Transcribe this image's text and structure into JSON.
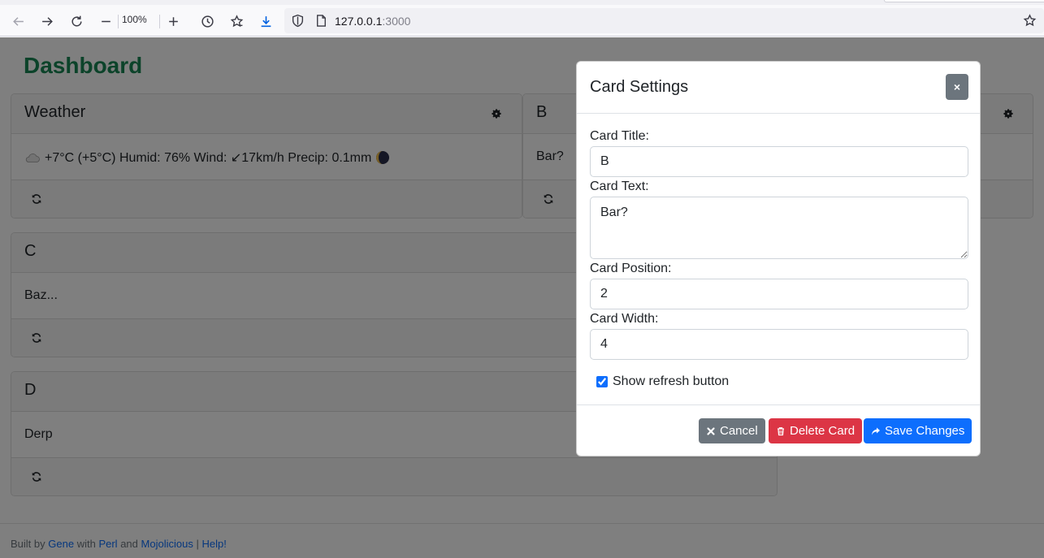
{
  "browser": {
    "zoom_level": "100%",
    "url_host": "127.0.0.1",
    "url_port": ":3000",
    "icons": [
      "back-icon",
      "forward-icon",
      "reload-icon",
      "zoom-out-icon",
      "zoom-in-icon",
      "history-icon",
      "bookmarks-icon",
      "download-icon",
      "shield-icon",
      "page-icon",
      "star-icon"
    ]
  },
  "page": {
    "title": "Dashboard",
    "cards": [
      {
        "title": "Weather",
        "text": "+7°C (+5°C) Humid: 76% Wind: ↙17km/h Precip: 0.1mm"
      },
      {
        "title": "B",
        "text": "Bar?"
      },
      {
        "title": "C",
        "text": "Baz..."
      },
      {
        "title": "D",
        "text": "Derp"
      }
    ],
    "footer": {
      "built_by": "Built by",
      "author": "Gene",
      "with": "with",
      "lang": "Perl",
      "and": "and",
      "framework": "Mojolicious",
      "pipe": "|",
      "help": "Help!"
    }
  },
  "modal": {
    "title": "Card Settings",
    "close_label": "×",
    "title_label": "Card Title:",
    "title_value": "B",
    "text_label": "Card Text:",
    "text_value": "Bar?",
    "position_label": "Card Position:",
    "position_value": "2",
    "width_label": "Card Width:",
    "width_value": "4",
    "refresh_label": "Show refresh button",
    "refresh_checked": true,
    "cancel_label": "Cancel",
    "delete_label": "Delete Card",
    "save_label": "Save Changes"
  },
  "colors": {
    "title_green": "#198754",
    "primary": "#0d6efd",
    "danger": "#dc3545",
    "secondary": "#6c757d"
  }
}
